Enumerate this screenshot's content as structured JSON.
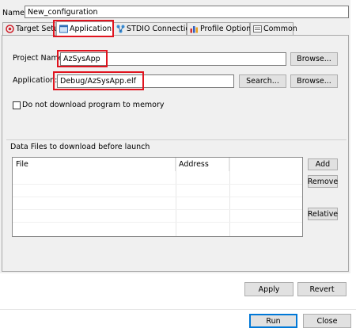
{
  "dialog": {
    "name_label": "Name:",
    "name_value": "New_configuration",
    "apply_label": "Apply",
    "revert_label": "Revert",
    "run_label": "Run",
    "close_label": "Close"
  },
  "tabs": [
    {
      "label": "Target Setup",
      "icon": "target-icon"
    },
    {
      "label": "Application",
      "icon": "application-window-icon",
      "active": true
    },
    {
      "label": "STDIO Connection",
      "icon": "connection-icon"
    },
    {
      "label": "Profile Options",
      "icon": "chart-bars-icon"
    },
    {
      "label": "Common",
      "icon": "common-icon"
    }
  ],
  "application": {
    "project_label": "Project Name:",
    "project_value": "AzSysApp",
    "app_label": "Application:",
    "app_value": "Debug/AzSysApp.elf",
    "browse_label": "Browse...",
    "search_label": "Search...",
    "no_download_label": "Do not download program to memory",
    "no_download_checked": false
  },
  "data_files": {
    "group_label": "Data Files to download before launch",
    "columns": [
      "File",
      "Address"
    ],
    "rows": [],
    "add_label": "Add",
    "remove_label": "Remove",
    "relative_label": "Relative"
  },
  "colors": {
    "highlight": "#e0141f",
    "panel_bg": "#f0f0f0",
    "primary_border": "#0078d7"
  }
}
